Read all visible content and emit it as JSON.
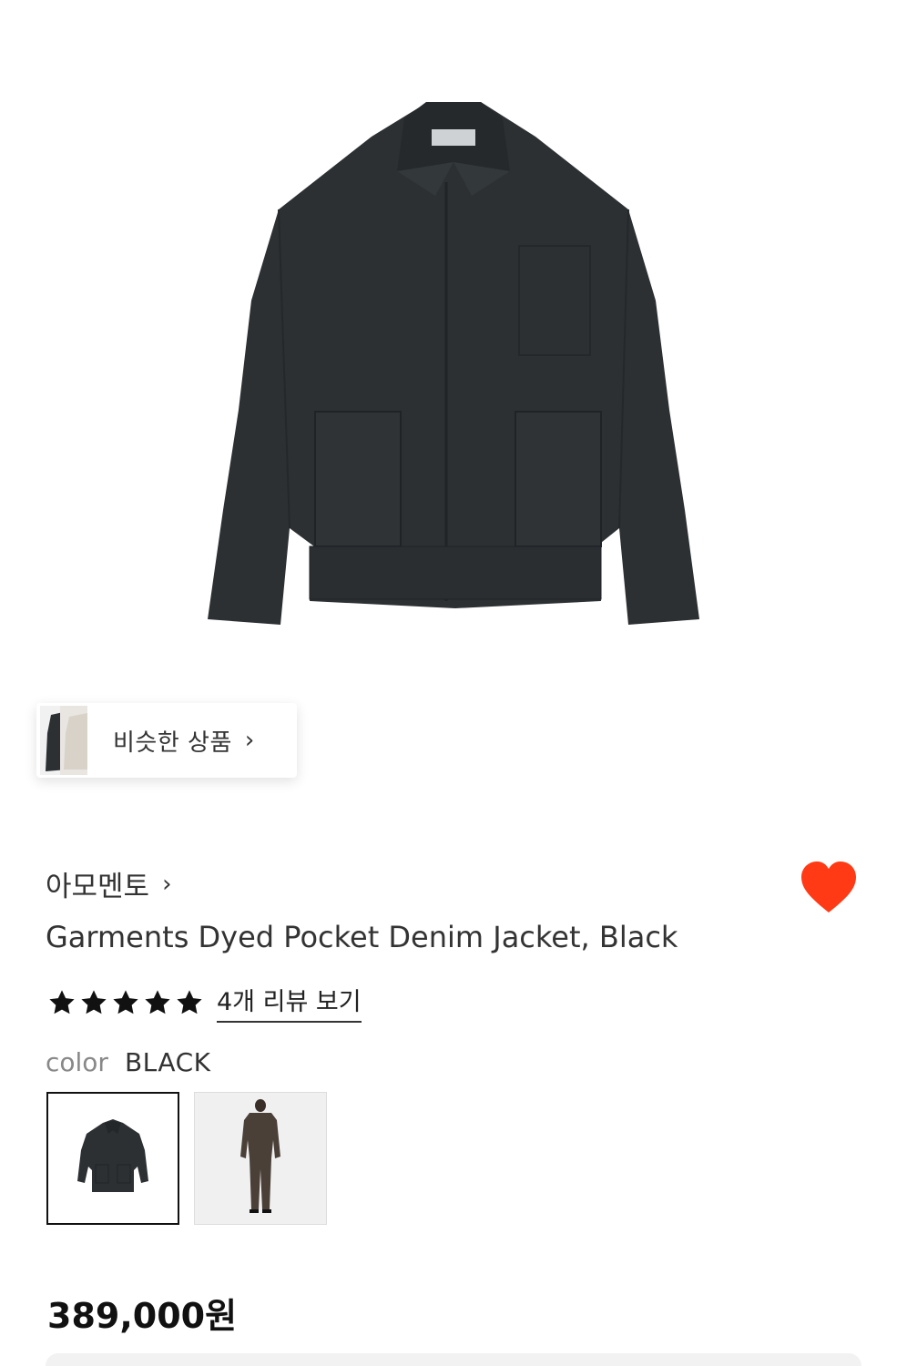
{
  "similar": {
    "label": "비슷한 상품",
    "chevron": "›"
  },
  "brand": {
    "name": "아모멘토",
    "chevron": "›"
  },
  "product": {
    "title": "Garments Dyed Pocket Denim Jacket, Black"
  },
  "rating": {
    "stars": 5,
    "max_stars": 5,
    "review_link": "4개 리뷰 보기"
  },
  "color": {
    "label": "color",
    "value": "BLACK"
  },
  "price": {
    "value": "389,000원"
  },
  "colors": {
    "heart": "#FF3A15",
    "jacket": "#2C3033",
    "text": "#333333"
  },
  "icons": {
    "wishlist": "heart-icon",
    "rating": "star-icon",
    "chevron": "chevron-right-icon"
  }
}
